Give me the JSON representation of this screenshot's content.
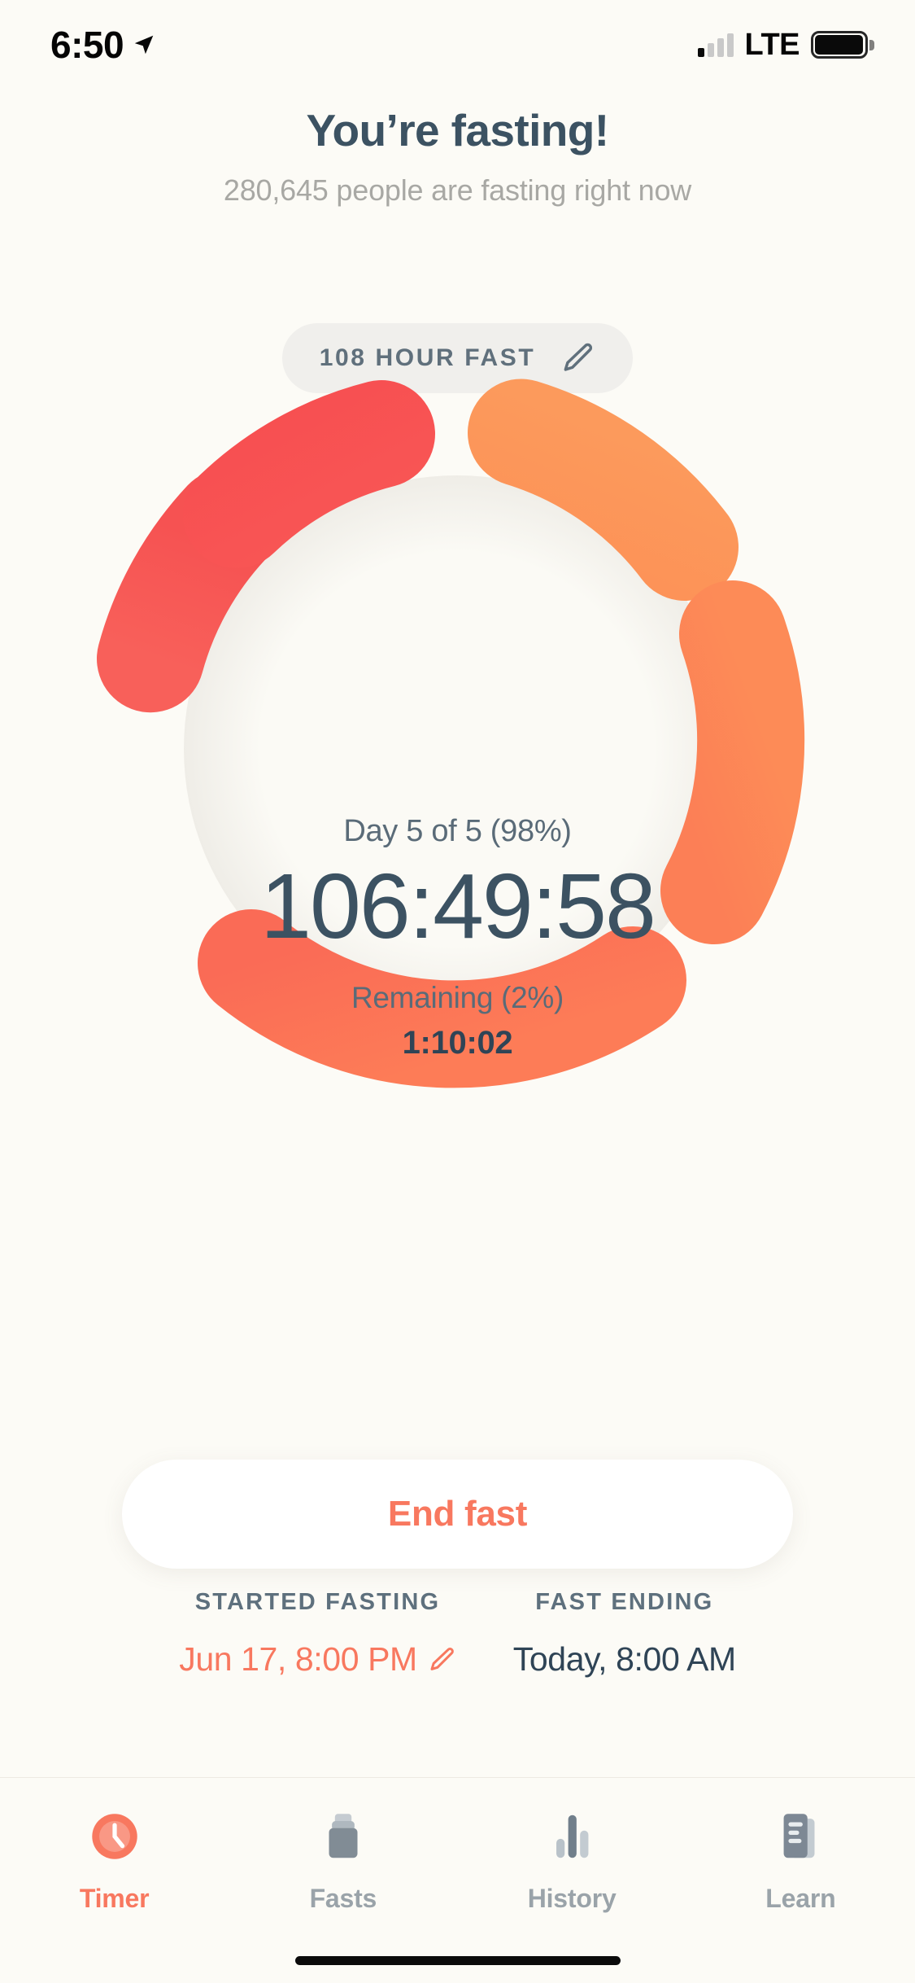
{
  "status_bar": {
    "time": "6:50",
    "location_icon": "location-arrow-icon",
    "carrier": "LTE",
    "signal_bars_filled": 1,
    "signal_bars_total": 4,
    "battery_icon": "battery-full-icon"
  },
  "header": {
    "title": "You’re fasting!",
    "subtitle": "280,645 people are fasting right now"
  },
  "fast_type_pill": {
    "label": "108 HOUR FAST",
    "edit_icon": "pencil-icon"
  },
  "timer": {
    "day_progress": "Day 5 of 5 (98%)",
    "elapsed": "106:49:58",
    "remaining_label": "Remaining (2%)",
    "remaining_value": "1:10:02"
  },
  "ring": {
    "segments": 5,
    "percent_complete": 98,
    "colors": [
      "#F75453",
      "#F95A54",
      "#FB6A56",
      "#FC7C55",
      "#FD9556"
    ],
    "track_color": "#FAF8F3"
  },
  "primary_action": {
    "label": "End fast"
  },
  "fast_window": {
    "start": {
      "caption": "STARTED FASTING",
      "value": "Jun 17, 8:00 PM",
      "edit_icon": "pencil-icon"
    },
    "end": {
      "caption": "FAST ENDING",
      "value": "Today, 8:00 AM"
    }
  },
  "tab_bar": {
    "items": [
      {
        "label": "Timer",
        "icon": "clock-icon",
        "active": true
      },
      {
        "label": "Fasts",
        "icon": "jar-icon",
        "active": false
      },
      {
        "label": "History",
        "icon": "bar-chart-icon",
        "active": false
      },
      {
        "label": "Learn",
        "icon": "article-icon",
        "active": false
      }
    ]
  },
  "colors": {
    "background": "#FCFBF6",
    "accent": "#F8785F",
    "text_dark": "#3C5262",
    "text_muted": "#A8A8A4"
  }
}
